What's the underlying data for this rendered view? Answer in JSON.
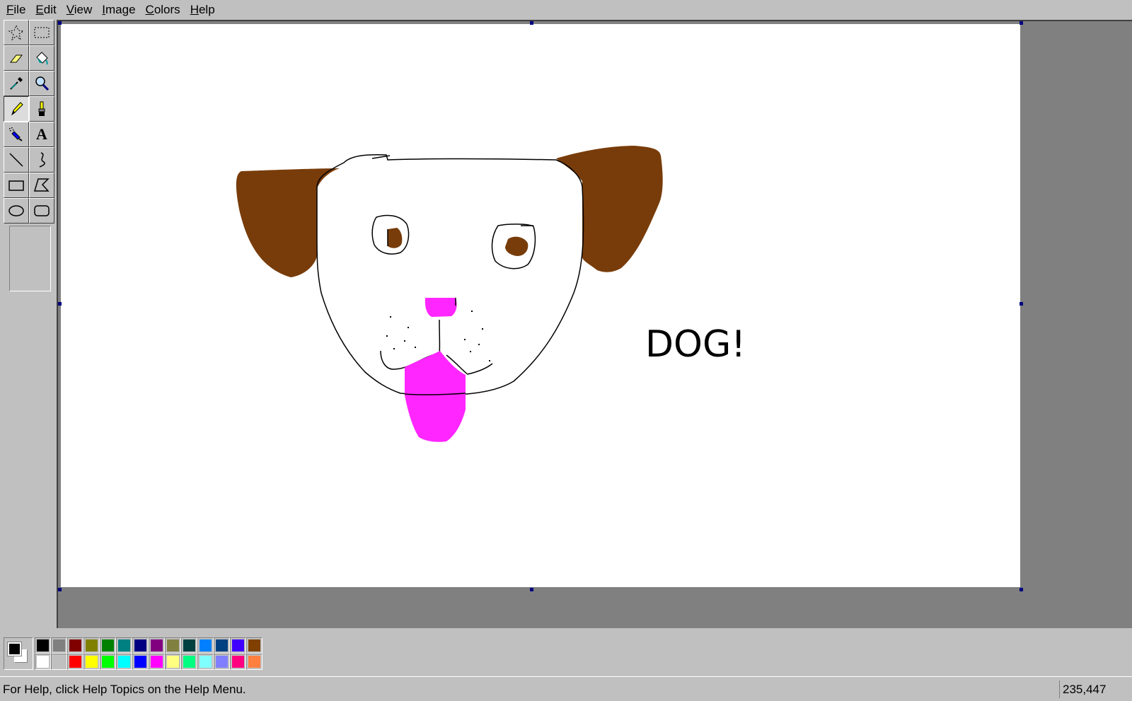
{
  "menu": [
    {
      "key": "F",
      "rest": "ile"
    },
    {
      "key": "E",
      "rest": "dit"
    },
    {
      "key": "V",
      "rest": "iew"
    },
    {
      "key": "I",
      "rest": "mage"
    },
    {
      "key": "C",
      "rest": "olors"
    },
    {
      "key": "H",
      "rest": "elp"
    }
  ],
  "tools": [
    {
      "name": "free-form-select-tool",
      "icon": "star-select-icon"
    },
    {
      "name": "select-tool",
      "icon": "rect-select-icon"
    },
    {
      "name": "eraser-tool",
      "icon": "eraser-icon"
    },
    {
      "name": "fill-tool",
      "icon": "paint-bucket-icon"
    },
    {
      "name": "pick-color-tool",
      "icon": "eyedropper-icon"
    },
    {
      "name": "magnifier-tool",
      "icon": "magnifier-icon"
    },
    {
      "name": "pencil-tool",
      "icon": "pencil-icon",
      "active": true
    },
    {
      "name": "brush-tool",
      "icon": "brush-icon"
    },
    {
      "name": "airbrush-tool",
      "icon": "airbrush-icon"
    },
    {
      "name": "text-tool",
      "icon": "text-icon",
      "glyph": "A"
    },
    {
      "name": "line-tool",
      "icon": "line-icon"
    },
    {
      "name": "curve-tool",
      "icon": "curve-icon"
    },
    {
      "name": "rectangle-tool",
      "icon": "rectangle-icon"
    },
    {
      "name": "polygon-tool",
      "icon": "polygon-icon"
    },
    {
      "name": "ellipse-tool",
      "icon": "ellipse-icon"
    },
    {
      "name": "rounded-rectangle-tool",
      "icon": "rounded-rectangle-icon"
    }
  ],
  "canvas": {
    "drawing_text": "DOG!",
    "colors": {
      "ear": "#783c0a",
      "eye": "#783c0a",
      "nose": "#ff26ff",
      "tongue": "#ff26ff",
      "outline": "#000000"
    }
  },
  "current_colors": {
    "foreground": "#000000",
    "background": "#ffffff"
  },
  "palette": {
    "row1": [
      "#000000",
      "#808080",
      "#800000",
      "#808000",
      "#008000",
      "#008080",
      "#000080",
      "#800080",
      "#808040",
      "#004040",
      "#0080ff",
      "#004080",
      "#4000ff",
      "#804000"
    ],
    "row2": [
      "#ffffff",
      "#c0c0c0",
      "#ff0000",
      "#ffff00",
      "#00ff00",
      "#00ffff",
      "#0000ff",
      "#ff00ff",
      "#ffff80",
      "#00ff80",
      "#80ffff",
      "#8080ff",
      "#ff0080",
      "#ff8040"
    ]
  },
  "status": {
    "help_text": "For Help, click Help Topics on the Help Menu.",
    "coords": "235,447"
  }
}
